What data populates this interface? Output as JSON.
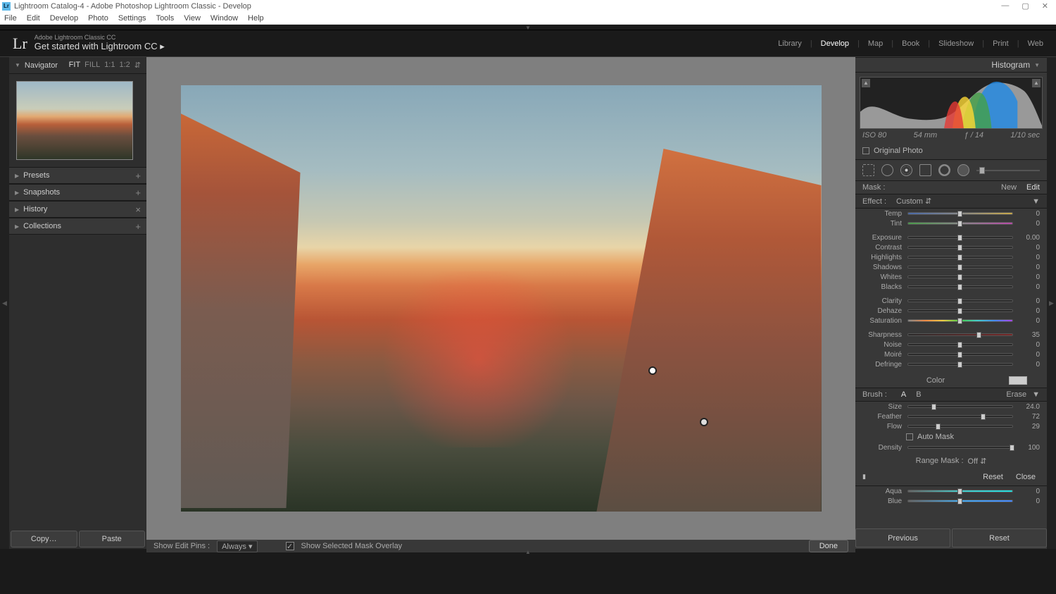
{
  "window": {
    "title": "Lightroom Catalog-4 - Adobe Photoshop Lightroom Classic - Develop"
  },
  "menus": [
    "File",
    "Edit",
    "Develop",
    "Photo",
    "Settings",
    "Tools",
    "View",
    "Window",
    "Help"
  ],
  "brand": {
    "sub": "Adobe Lightroom Classic CC",
    "title": "Get started with Lightroom CC  ▸"
  },
  "modules": [
    "Library",
    "Develop",
    "Map",
    "Book",
    "Slideshow",
    "Print",
    "Web"
  ],
  "module_active": "Develop",
  "left": {
    "navigator": {
      "label": "Navigator",
      "fit": "FIT",
      "fill": "FILL",
      "r1": "1:1",
      "r2": "1:2"
    },
    "panels": [
      {
        "label": "Presets",
        "action": "+"
      },
      {
        "label": "Snapshots",
        "action": "+"
      },
      {
        "label": "History",
        "action": "×"
      },
      {
        "label": "Collections",
        "action": "+"
      }
    ],
    "copy": "Copy…",
    "paste": "Paste"
  },
  "toolbar": {
    "show_pins": "Show Edit Pins :",
    "pins_mode": "Always",
    "overlay": "Show Selected Mask Overlay",
    "done": "Done"
  },
  "right": {
    "histogram": {
      "label": "Histogram",
      "iso": "ISO 80",
      "focal": "54 mm",
      "aperture": "ƒ / 14",
      "shutter": "1/10 sec",
      "orig": "Original Photo"
    },
    "mask": {
      "label": "Mask :",
      "new": "New",
      "edit": "Edit"
    },
    "effect": {
      "label": "Effect :",
      "value": "Custom"
    },
    "sliders1": [
      {
        "lbl": "Temp",
        "val": "0",
        "cls": "temp",
        "pos": 50
      },
      {
        "lbl": "Tint",
        "val": "0",
        "cls": "tint",
        "pos": 50
      }
    ],
    "sliders2": [
      {
        "lbl": "Exposure",
        "val": "0.00",
        "pos": 50
      },
      {
        "lbl": "Contrast",
        "val": "0",
        "pos": 50
      },
      {
        "lbl": "Highlights",
        "val": "0",
        "pos": 50
      },
      {
        "lbl": "Shadows",
        "val": "0",
        "pos": 50
      },
      {
        "lbl": "Whites",
        "val": "0",
        "pos": 50
      },
      {
        "lbl": "Blacks",
        "val": "0",
        "pos": 50
      }
    ],
    "sliders3": [
      {
        "lbl": "Clarity",
        "val": "0",
        "pos": 50
      },
      {
        "lbl": "Dehaze",
        "val": "0",
        "pos": 50
      },
      {
        "lbl": "Saturation",
        "val": "0",
        "cls": "sat",
        "pos": 50
      }
    ],
    "sliders4": [
      {
        "lbl": "Sharpness",
        "val": "35",
        "cls": "sharp",
        "pos": 68
      },
      {
        "lbl": "Noise",
        "val": "0",
        "pos": 50
      },
      {
        "lbl": "Moiré",
        "val": "0",
        "pos": 50
      },
      {
        "lbl": "Defringe",
        "val": "0",
        "pos": 50
      }
    ],
    "color": {
      "label": "Color"
    },
    "brush": {
      "label": "Brush :",
      "a": "A",
      "b": "B",
      "erase": "Erase"
    },
    "sliders5": [
      {
        "lbl": "Size",
        "val": "24.0",
        "pos": 25
      },
      {
        "lbl": "Feather",
        "val": "72",
        "pos": 72
      },
      {
        "lbl": "Flow",
        "val": "29",
        "pos": 29
      }
    ],
    "automask": "Auto Mask",
    "sliders6": [
      {
        "lbl": "Density",
        "val": "100",
        "pos": 100
      }
    ],
    "range": {
      "label": "Range Mask :",
      "value": "Off"
    },
    "reset": "Reset",
    "close": "Close",
    "sliders7": [
      {
        "lbl": "Aqua",
        "val": "0",
        "cls": "color-a",
        "pos": 50
      },
      {
        "lbl": "Blue",
        "val": "0",
        "cls": "color-b",
        "pos": 50
      }
    ],
    "previous": "Previous",
    "reset2": "Reset"
  }
}
